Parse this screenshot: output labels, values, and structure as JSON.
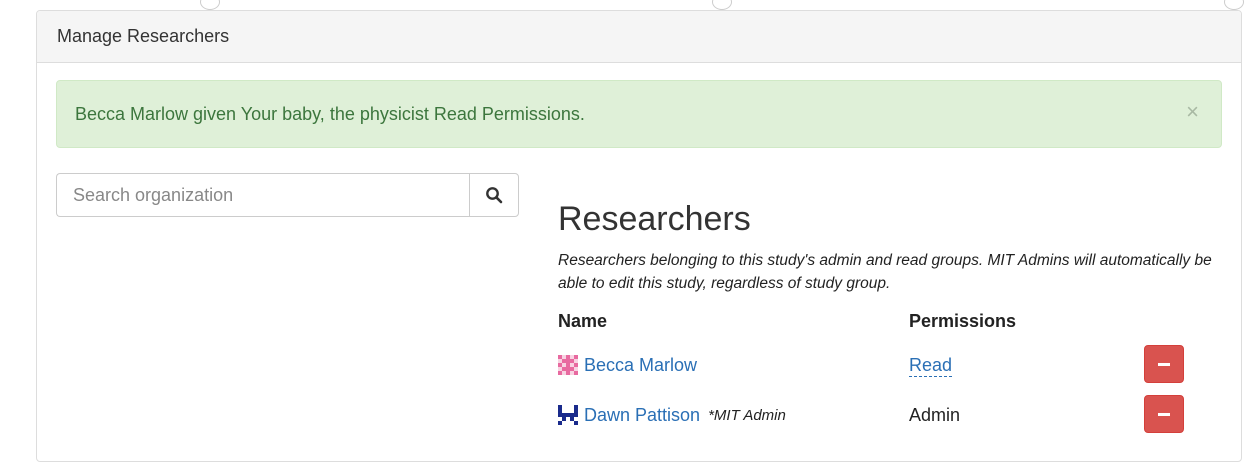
{
  "panel": {
    "title": "Manage Researchers"
  },
  "alert": {
    "message": "Becca Marlow given Your baby, the physicist Read Permissions.",
    "close_glyph": "×"
  },
  "search": {
    "placeholder": "Search organization"
  },
  "researchers": {
    "heading": "Researchers",
    "description": "Researchers belonging to this study's admin and read groups. MIT Admins will automatically be able to edit this study, regardless of study group.",
    "columns": {
      "name": "Name",
      "permissions": "Permissions"
    },
    "rows": [
      {
        "name": "Becca Marlow",
        "note": "",
        "permission": "Read",
        "permission_editable": true,
        "avatar_color": "#e86aa0"
      },
      {
        "name": "Dawn Pattison",
        "note": "*MIT Admin",
        "permission": "Admin",
        "permission_editable": false,
        "avatar_color": "#1a2b8c"
      }
    ]
  },
  "colors": {
    "alert_bg": "#dff0d8",
    "alert_text": "#3c763d",
    "link": "#2a6fb5",
    "danger": "#d9534f"
  },
  "icons": {
    "search": "search-icon",
    "remove": "minus-icon",
    "close": "close-icon"
  }
}
